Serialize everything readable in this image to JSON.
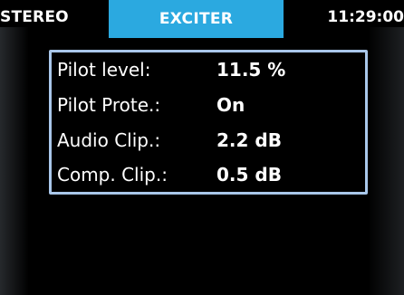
{
  "status_bar": {
    "mode": "STEREO",
    "active_tab": "EXCITER",
    "time": "11:29:00"
  },
  "panel": {
    "rows": [
      {
        "label": "Pilot level:",
        "value": "11.5 %"
      },
      {
        "label": "Pilot Prote.:",
        "value": "On"
      },
      {
        "label": "Audio Clip.:",
        "value": "2.2 dB"
      },
      {
        "label": "Comp. Clip.:",
        "value": "0.5 dB"
      }
    ]
  },
  "colors": {
    "background": "#000000",
    "tab_accent": "#2ba9e0",
    "panel_border": "#a9c7ea",
    "text": "#ffffff"
  }
}
